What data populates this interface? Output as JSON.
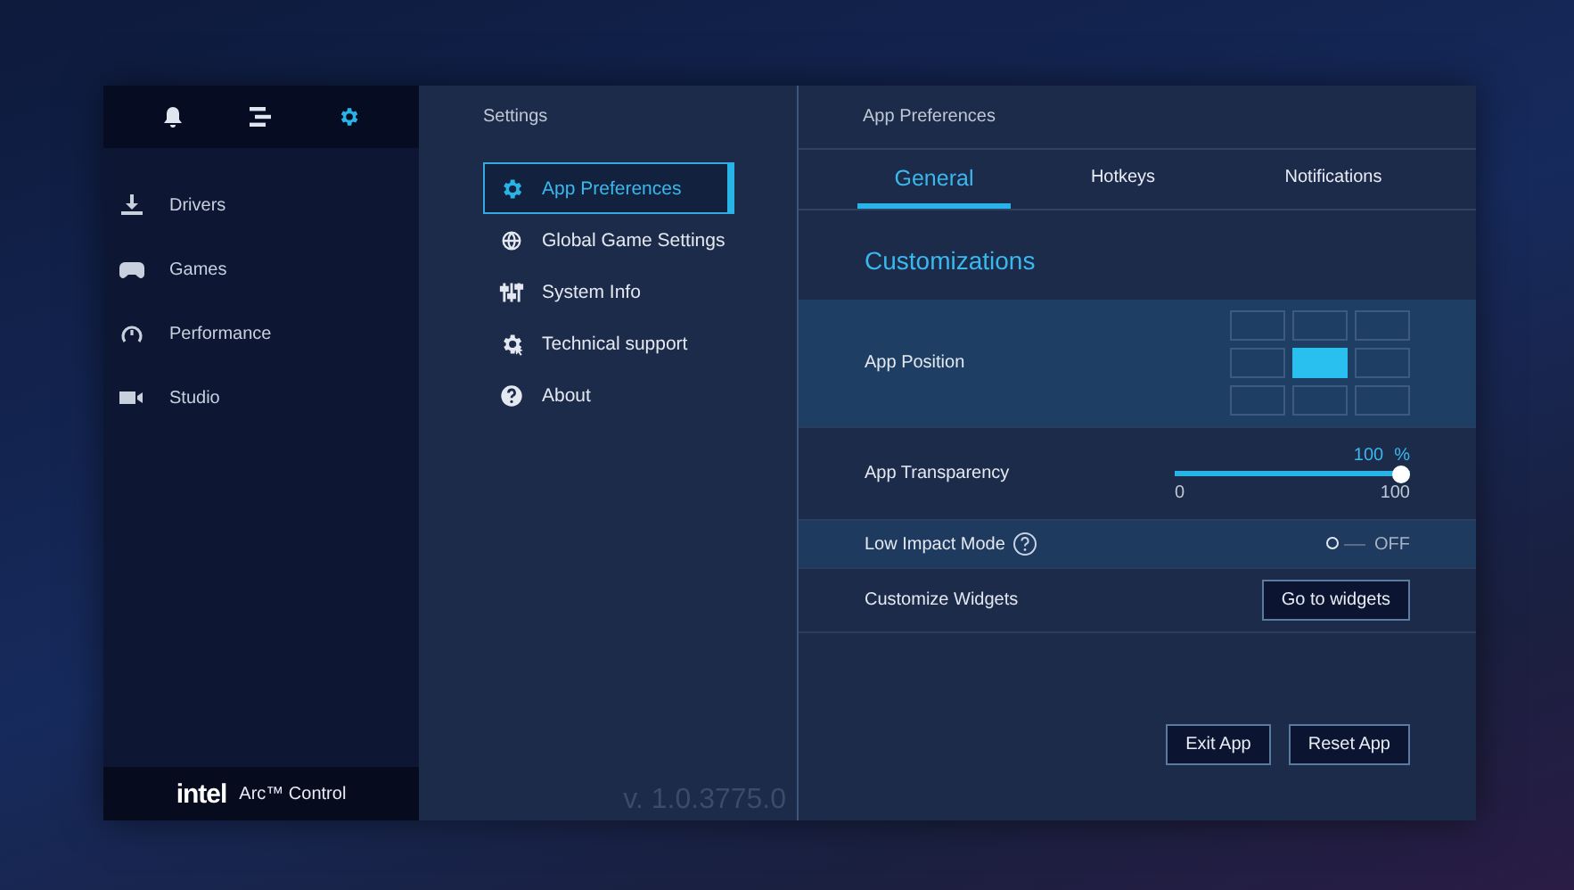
{
  "top_icons": [
    {
      "kind": "bell",
      "selected": false
    },
    {
      "kind": "bars",
      "selected": false
    },
    {
      "kind": "gear",
      "selected": true
    }
  ],
  "nav": [
    {
      "kind": "download",
      "label": "Drivers"
    },
    {
      "kind": "gamepad",
      "label": "Games"
    },
    {
      "kind": "gauge",
      "label": "Performance"
    },
    {
      "kind": "camera",
      "label": "Studio"
    }
  ],
  "brand": {
    "logo": "intel",
    "product": "Arc™ Control"
  },
  "settings": {
    "title": "Settings",
    "items": [
      {
        "kind": "gear",
        "label": "App Preferences",
        "selected": true
      },
      {
        "kind": "globe",
        "label": "Global Game Settings",
        "selected": false
      },
      {
        "kind": "sliders",
        "label": "System Info",
        "selected": false
      },
      {
        "kind": "support",
        "label": "Technical support",
        "selected": false
      },
      {
        "kind": "help",
        "label": "About",
        "selected": false
      }
    ],
    "version": "v. 1.0.3775.0"
  },
  "panel": {
    "title": "App Preferences",
    "tabs": [
      {
        "label": "General",
        "selected": true
      },
      {
        "label": "Hotkeys",
        "selected": false
      },
      {
        "label": "Notifications",
        "selected": false
      }
    ],
    "section": "Customizations",
    "rows": [
      {
        "kind": "position",
        "label": "App Position",
        "cells": [
          {
            "selected": false
          },
          {
            "selected": false
          },
          {
            "selected": false
          },
          {
            "selected": false
          },
          {
            "selected": true
          },
          {
            "selected": false
          },
          {
            "selected": false
          },
          {
            "selected": false
          },
          {
            "selected": false
          }
        ]
      },
      {
        "kind": "slider",
        "label": "App Transparency",
        "level": 1,
        "reading": "100",
        "unit": "%",
        "min": "0",
        "max": "100"
      },
      {
        "kind": "toggle",
        "label": "Low Impact Mode",
        "help": true,
        "on": false,
        "state_text": "OFF"
      },
      {
        "kind": "button",
        "label": "Customize Widgets",
        "button": "Go to widgets"
      }
    ],
    "actions": [
      "Exit App",
      "Reset App"
    ]
  }
}
